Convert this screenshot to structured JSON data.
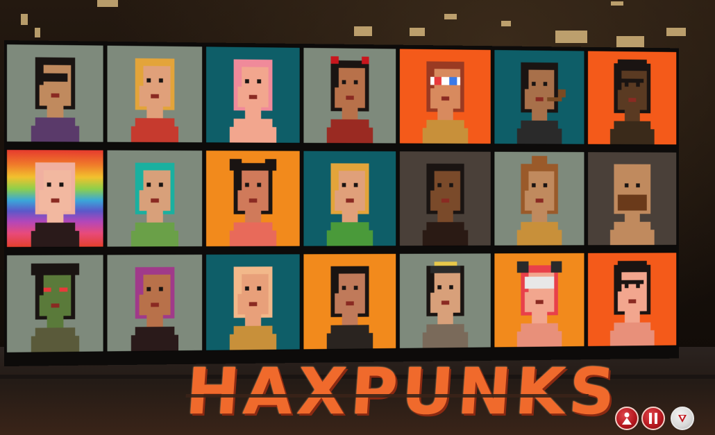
{
  "title": "HAXPUNKS",
  "colors": {
    "gray": "#7e8a7c",
    "teal": "#0e5e68",
    "orange": "#f28a1c",
    "redorange": "#f45a1a",
    "brown": "#4a4039",
    "brand": "#f06a2c"
  },
  "grid": [
    [
      {
        "bg": "gray",
        "hair": "#1a1412",
        "skin": "#c08a5e",
        "acc": "glasses",
        "body": "#5a3a6a"
      },
      {
        "bg": "gray",
        "hair": "#e3a43a",
        "skin": "#e0a07a",
        "acc": "none",
        "body": "#c63a2e"
      },
      {
        "bg": "teal",
        "hair": "#f08a9a",
        "skin": "#f2a68e",
        "acc": "none",
        "body": "#f2a68e"
      },
      {
        "bg": "gray",
        "hair": "#1a1412",
        "skin": "#b8714a",
        "acc": "horns",
        "body": "#9a2a22"
      },
      {
        "bg": "redorange",
        "hair": "#9a3a22",
        "skin": "#d88a5e",
        "acc": "3dglasses",
        "body": "#c8903a"
      },
      {
        "bg": "teal",
        "hair": "#1a1412",
        "skin": "#a8704a",
        "acc": "pipe",
        "body": "#2a2a2a"
      },
      {
        "bg": "redorange",
        "hair": "#1a1412",
        "skin": "#5a3a22",
        "acc": "cap",
        "body": "#3a2a1a"
      }
    ],
    [
      {
        "bg": "rainbow",
        "hair": "#f0b0a0",
        "skin": "#f2b8a0",
        "acc": "none",
        "body": "#2a1a1a"
      },
      {
        "bg": "gray",
        "hair": "#1ab0a0",
        "skin": "#d8a07a",
        "acc": "none",
        "body": "#6aa048"
      },
      {
        "bg": "orange",
        "hair": "#1a1412",
        "skin": "#d07a5a",
        "acc": "buns",
        "body": "#e86a5a"
      },
      {
        "bg": "teal",
        "hair": "#e3a43a",
        "skin": "#e0a07a",
        "acc": "none",
        "body": "#4a9a3a"
      },
      {
        "bg": "brown",
        "hair": "#1a1412",
        "skin": "#7a4a2a",
        "acc": "none",
        "body": "#2a1a14"
      },
      {
        "bg": "gray",
        "hair": "#9a5a2a",
        "skin": "#c08a5e",
        "acc": "bun",
        "body": "#c8903a"
      },
      {
        "bg": "brown",
        "hair": "#c08a5e",
        "skin": "#c08a5e",
        "acc": "beard",
        "body": "#c08a5e"
      }
    ],
    [
      {
        "bg": "gray",
        "hair": "#1a1412",
        "skin": "#5a7a3a",
        "acc": "zombie",
        "body": "#5a5a3a"
      },
      {
        "bg": "gray",
        "hair": "#a03a8a",
        "skin": "#b8714a",
        "acc": "none",
        "body": "#2a1a1a"
      },
      {
        "bg": "teal",
        "hair": "#f2b88a",
        "skin": "#e8a07a",
        "acc": "none",
        "body": "#c8903a"
      },
      {
        "bg": "orange",
        "hair": "#1a1412",
        "skin": "#c07a5a",
        "acc": "none",
        "body": "#2a2420"
      },
      {
        "bg": "gray",
        "hair": "#1a1412",
        "skin": "#d8a07a",
        "acc": "hat",
        "body": "#7a6a5a"
      },
      {
        "bg": "orange",
        "hair": "#e8404a",
        "skin": "#f2a68e",
        "acc": "vr",
        "body": "#e8907a"
      },
      {
        "bg": "redorange",
        "hair": "#1a1412",
        "skin": "#f2a68e",
        "acc": "cap",
        "body": "#e8907a"
      }
    ]
  ],
  "hud": {
    "buttons": [
      {
        "name": "avatar-button"
      },
      {
        "name": "pause-button"
      },
      {
        "name": "play-button"
      }
    ]
  }
}
